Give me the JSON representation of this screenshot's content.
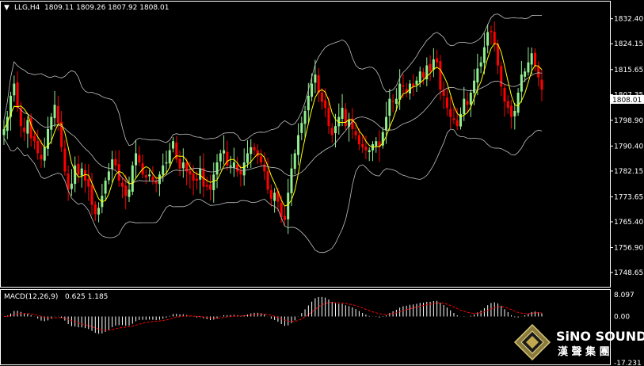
{
  "header": {
    "arrow": "▼",
    "symbol": "LLG,H4",
    "ohlc": "1809.11 1809.26 1807.92 1808.01"
  },
  "macd_header": {
    "label": "MACD(12,26,9)",
    "values": "0.625 1.185"
  },
  "brand": {
    "name": "SiNO SOUND",
    "chinese": "漢 聲 集 團"
  },
  "colors": {
    "background": "#000000",
    "bull": "#90ee90",
    "bear": "#ff0000",
    "ma": "#ffff00",
    "bands": "#c0c0c0",
    "macd_hist": "#ffffff",
    "macd_signal": "#ff0000"
  },
  "chart_data": [
    {
      "type": "candlestick",
      "instrument": "LLG",
      "timeframe": "H4",
      "ylim": [
        1745.0,
        1836.5
      ],
      "y_ticks": [
        "1832.40",
        "1824.15",
        "1815.65",
        "1807.35",
        "1798.90",
        "1790.40",
        "1782.15",
        "1773.65",
        "1765.40",
        "1756.90",
        "1748.65"
      ],
      "current_price": "1808.01",
      "indicators": [
        "Bollinger Bands",
        "Moving Average"
      ],
      "closes": [
        1796,
        1800,
        1807,
        1811,
        1803,
        1797,
        1795,
        1799,
        1793,
        1792,
        1788,
        1786,
        1790,
        1796,
        1800,
        1804,
        1798,
        1790,
        1782,
        1776,
        1778,
        1784,
        1781,
        1783,
        1779,
        1777,
        1771,
        1768,
        1770,
        1774,
        1779,
        1782,
        1786,
        1784,
        1779,
        1777,
        1774,
        1776,
        1784,
        1788,
        1785,
        1781,
        1780,
        1781,
        1779,
        1778,
        1781,
        1784,
        1785,
        1789,
        1792,
        1786,
        1783,
        1785,
        1782,
        1781,
        1779,
        1779,
        1783,
        1777,
        1777,
        1776,
        1781,
        1785,
        1788,
        1789,
        1784,
        1784,
        1785,
        1782,
        1781,
        1785,
        1788,
        1790,
        1789,
        1787,
        1785,
        1782,
        1776,
        1773,
        1775,
        1772,
        1767,
        1766,
        1775,
        1783,
        1788,
        1794,
        1798,
        1802,
        1807,
        1811,
        1814,
        1808,
        1805,
        1803,
        1797,
        1794,
        1797,
        1800,
        1803,
        1797,
        1799,
        1796,
        1794,
        1791,
        1790,
        1789,
        1789,
        1791,
        1792,
        1790,
        1795,
        1800,
        1806,
        1805,
        1806,
        1811,
        1810,
        1808,
        1811,
        1810,
        1812,
        1815,
        1813,
        1817,
        1815,
        1819,
        1818,
        1809,
        1807,
        1803,
        1800,
        1799,
        1797,
        1801,
        1806,
        1804,
        1808,
        1812,
        1816,
        1818,
        1823,
        1828,
        1828,
        1824,
        1817,
        1810,
        1805,
        1803,
        1800,
        1802,
        1808,
        1814,
        1815,
        1818,
        1821,
        1817,
        1813,
        1809
      ],
      "macd_ylim": [
        -17.231,
        8.097
      ],
      "macd_ticks": [
        "8.097",
        "0.00",
        "-17.231"
      ]
    }
  ]
}
